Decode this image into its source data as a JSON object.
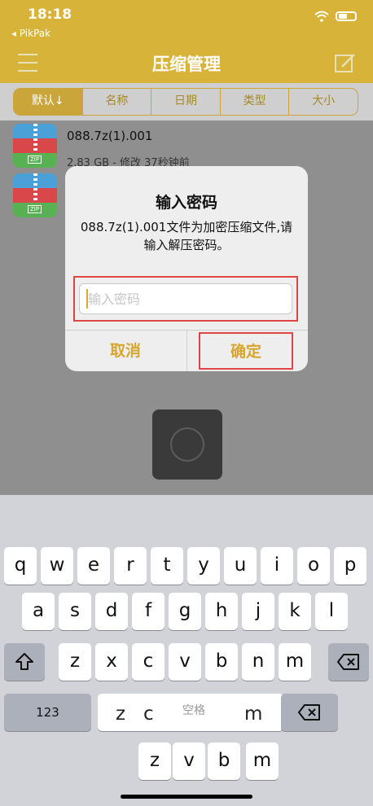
{
  "status": {
    "time": "18:18",
    "back_app": "◂ PikPak"
  },
  "nav": {
    "title": "压缩管理"
  },
  "sort_tabs": [
    "默认↓",
    "名称",
    "日期",
    "类型",
    "大小"
  ],
  "files": [
    {
      "name": "088.7z(1).001",
      "meta": "2.83 GB - 修改 37秒钟前"
    },
    {
      "name": "",
      "meta": ""
    }
  ],
  "zip_label": "ZIP",
  "dialog": {
    "title": "输入密码",
    "message": "088.7z(1).001文件为加密压缩文件,请输入解压密码。",
    "placeholder": "输入密码",
    "cancel": "取消",
    "ok": "确定"
  },
  "keyboard": {
    "row1": [
      "q",
      "w",
      "e",
      "r",
      "t",
      "y",
      "u",
      "i",
      "o",
      "p"
    ],
    "row2": [
      "a",
      "s",
      "d",
      "f",
      "g",
      "h",
      "j",
      "k",
      "l"
    ],
    "row3": [
      "z",
      "x",
      "c",
      "v",
      "b",
      "n",
      "m"
    ],
    "numbers_label": "123",
    "ghost_row": [
      "z",
      "c",
      "空格",
      "m"
    ],
    "ghost_row2": [
      "z",
      "v",
      "b",
      "m"
    ]
  },
  "colors": {
    "accent": "#d8b33a",
    "highlight_box": "#e04444"
  }
}
